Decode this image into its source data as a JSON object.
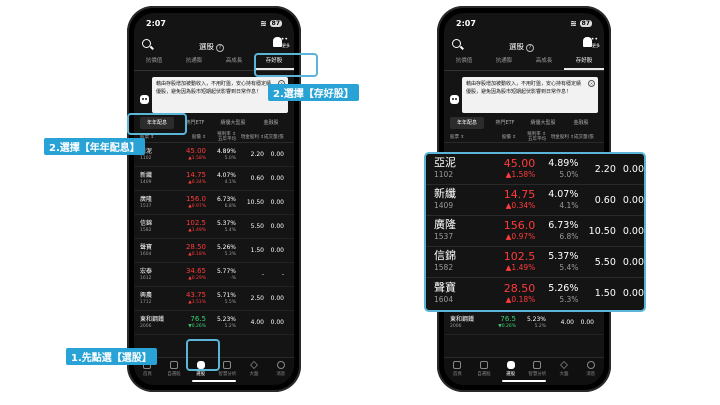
{
  "status": {
    "time": "2:07",
    "battery": "87"
  },
  "nav": {
    "title": "選股",
    "help": "?",
    "bell_label": "更多",
    "bell_dots": "•••"
  },
  "tabs": [
    "抗價值",
    "抗通膨",
    "高成長",
    "存好股"
  ],
  "banner": {
    "text": "藉由存股增加被動收入，不用盯盤，安心持有穩定績優股，避免因為股市短期起伏影響到日常作息！",
    "close": "×"
  },
  "subtabs": [
    "年年配息",
    "熱門ETF",
    "績優大型股",
    "金融股"
  ],
  "table_header": {
    "name": "股票 ⇕",
    "price": "股價 ⇕",
    "yield": "殖利率 ⇕\n五年平均",
    "dividend": "現金股利 ⇕",
    "volume": "成交量(張) ⇕"
  },
  "left_rows": [
    {
      "name": "亞泥",
      "code": "1102",
      "price": "45.00",
      "chg": "▲1.58%",
      "dir": "up",
      "yield": "4.89%",
      "avg": "5.0%",
      "dividend": "2.20",
      "vol": "0.00"
    },
    {
      "name": "新纖",
      "code": "1409",
      "price": "14.75",
      "chg": "▲0.34%",
      "dir": "up",
      "yield": "4.07%",
      "avg": "4.1%",
      "dividend": "0.60",
      "vol": "0.00"
    },
    {
      "name": "廣隆",
      "code": "1537",
      "price": "156.0",
      "chg": "▲0.97%",
      "dir": "up",
      "yield": "6.73%",
      "avg": "6.8%",
      "dividend": "10.50",
      "vol": "0.00"
    },
    {
      "name": "信錦",
      "code": "1582",
      "price": "102.5",
      "chg": "▲1.49%",
      "dir": "up",
      "yield": "5.37%",
      "avg": "5.4%",
      "dividend": "5.50",
      "vol": "0.00"
    },
    {
      "name": "聲寶",
      "code": "1604",
      "price": "28.50",
      "chg": "▲0.18%",
      "dir": "up",
      "yield": "5.26%",
      "avg": "5.3%",
      "dividend": "1.50",
      "vol": "0.00"
    },
    {
      "name": "宏泰",
      "code": "1612",
      "price": "34.65",
      "chg": "▲0.29%",
      "dir": "up",
      "yield": "5.77%",
      "avg": "-%",
      "dividend": "-",
      "vol": "-"
    },
    {
      "name": "興農",
      "code": "1712",
      "price": "43.75",
      "chg": "▲1.51%",
      "dir": "up",
      "yield": "5.71%",
      "avg": "5.5%",
      "dividend": "2.50",
      "vol": "0.00"
    },
    {
      "name": "東和鋼鐵",
      "code": "2006",
      "price": "76.5",
      "chg": "▼0.26%",
      "dir": "down",
      "yield": "5.23%",
      "avg": "5.2%",
      "dividend": "4.00",
      "vol": "0.00"
    }
  ],
  "bottom_nav": [
    "首頁",
    "自選股",
    "選股",
    "智慧分析",
    "大盤",
    "消息"
  ],
  "annotations": {
    "step1": "1.先點選【選股】",
    "step2": "2.選擇【存好股】",
    "step3": "2.選擇【年年配息】"
  },
  "colors": {
    "up": "#ff3b3b",
    "down": "#3ad173",
    "highlight": "#5ab5d9",
    "label_bg": "#29a3d6"
  }
}
